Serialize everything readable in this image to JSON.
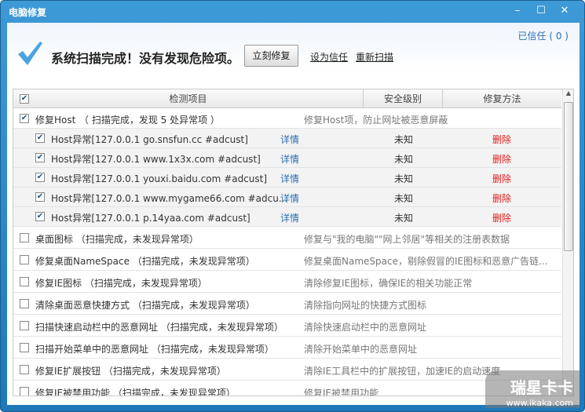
{
  "window": {
    "title": "电脑修复"
  },
  "header": {
    "trusted": "已信任 ( 0 )",
    "message": "系统扫描完成！没有发现危险项。",
    "fix_button": "立刻修复",
    "trust_link": "设为信任",
    "rescan_link": "重新扫描"
  },
  "columns": {
    "item": "检测项目",
    "level": "安全级别",
    "method": "修复方法"
  },
  "group": {
    "name": "修复Host",
    "status": "（ 扫描完成，发现 5 处异常项 ）",
    "desc": "修复Host项，防止网址被恶意屏蔽",
    "checked": true
  },
  "host_items": [
    {
      "text": "Host异常[127.0.0.1 go.snsfun.cc #adcust]",
      "detail": "详情",
      "level": "未知",
      "action": "删除"
    },
    {
      "text": "Host异常[127.0.0.1 www.1x3x.com #adcust]",
      "detail": "详情",
      "level": "未知",
      "action": "删除"
    },
    {
      "text": "Host异常[127.0.0.1 youxi.baidu.com #adcust]",
      "detail": "详情",
      "level": "未知",
      "action": "删除"
    },
    {
      "text": "Host异常[127.0.0.1 www.mygame66.com #adcu...",
      "detail": "详情",
      "level": "未知",
      "action": "删除"
    },
    {
      "text": "Host异常[127.0.0.1 p.14yaa.com #adcust]",
      "detail": "详情",
      "level": "未知",
      "action": "删除"
    }
  ],
  "items": [
    {
      "name": "桌面图标 （扫描完成，未发现异常项）",
      "desc": "修复与\"我的电脑\"\"网上邻居\"等相关的注册表数据"
    },
    {
      "name": "修复桌面NameSpace （扫描完成，未发现异常项）",
      "desc": "修复桌面NameSpace，剔除假冒的IE图标和恶意广告链..."
    },
    {
      "name": "修复IE图标 （扫描完成，未发现异常项）",
      "desc": "清除修复IE图标，确保IE的相关功能正常"
    },
    {
      "name": "清除桌面恶意快捷方式 （扫描完成，未发现异常项）",
      "desc": "清除指向网址的快捷方式图标"
    },
    {
      "name": "扫描快速启动栏中的恶意网址 （扫描完成，未发现异常项）",
      "desc": "清除快速启动栏中的恶意网址"
    },
    {
      "name": "扫描开始菜单中的恶意网址 （扫描完成，未发现异常项）",
      "desc": "清除开始菜单中的恶意网址"
    },
    {
      "name": "修复IE扩展按钮 （扫描完成，未发现异常项）",
      "desc": "清除IE工具栏中的扩展按钮，加速IE的启动速度"
    },
    {
      "name": "修复IE被禁用功能 （扫描完成，未发现异常项）",
      "desc": "修复IE被禁用功能"
    }
  ],
  "watermark": {
    "line1": "瑞星卡卡",
    "line2": "www.ikaka.com"
  }
}
